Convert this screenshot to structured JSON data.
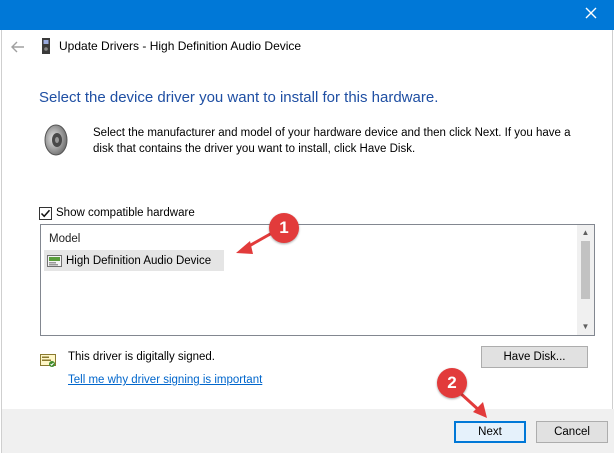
{
  "window": {
    "title": "Update Drivers - High Definition Audio Device",
    "accent": "#0078d7"
  },
  "header": {
    "heading": "Select the device driver you want to install for this hardware.",
    "description": "Select the manufacturer and model of your hardware device and then click Next. If you have a disk that contains the driver you want to install, click Have Disk."
  },
  "compatible": {
    "checked": true,
    "label": "Show compatible hardware"
  },
  "model_list": {
    "column": "Model",
    "items": [
      {
        "label": "High Definition Audio Device",
        "selected": true
      }
    ]
  },
  "signing": {
    "status": "This driver is digitally signed.",
    "link": "Tell me why driver signing is important"
  },
  "buttons": {
    "have_disk": "Have Disk...",
    "next": "Next",
    "cancel": "Cancel"
  },
  "annotations": {
    "badge1": "1",
    "badge2": "2",
    "color": "#e23b3b"
  }
}
